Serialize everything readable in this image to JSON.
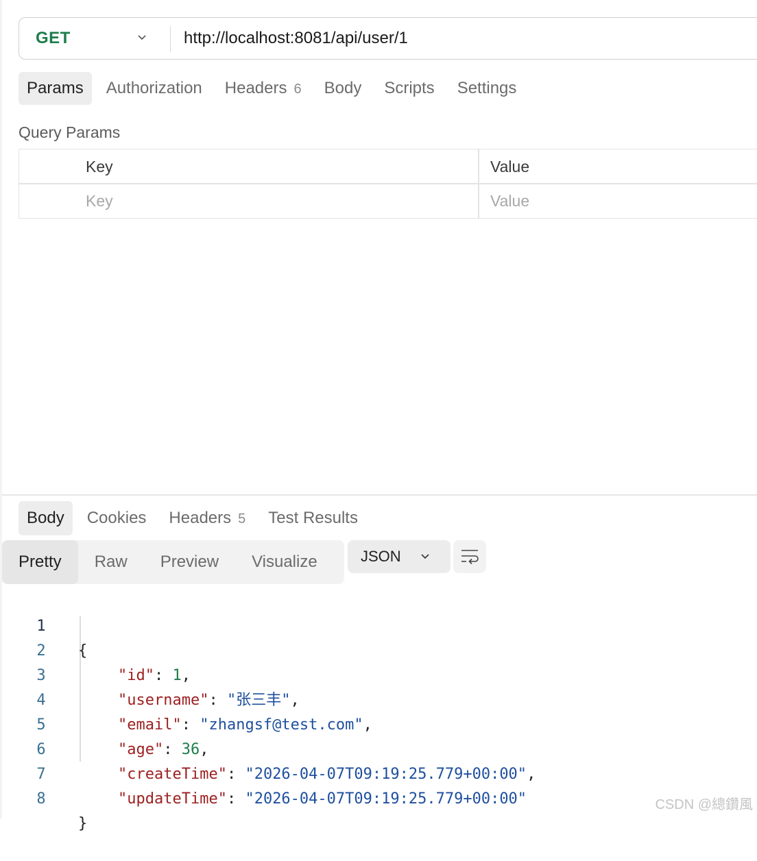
{
  "request": {
    "method": "GET",
    "url": "http://localhost:8081/api/user/1"
  },
  "request_tabs": [
    {
      "label": "Params",
      "active": true
    },
    {
      "label": "Authorization"
    },
    {
      "label": "Headers",
      "count": "6"
    },
    {
      "label": "Body"
    },
    {
      "label": "Scripts"
    },
    {
      "label": "Settings"
    }
  ],
  "query_params": {
    "title": "Query Params",
    "headers": {
      "key": "Key",
      "value": "Value"
    },
    "placeholders": {
      "key": "Key",
      "value": "Value"
    }
  },
  "response_tabs": [
    {
      "label": "Body",
      "active": true
    },
    {
      "label": "Cookies"
    },
    {
      "label": "Headers",
      "count": "5"
    },
    {
      "label": "Test Results"
    }
  ],
  "view_modes": [
    {
      "label": "Pretty",
      "active": true
    },
    {
      "label": "Raw"
    },
    {
      "label": "Preview"
    },
    {
      "label": "Visualize"
    }
  ],
  "format": "JSON",
  "code": {
    "line_numbers": [
      "1",
      "2",
      "3",
      "4",
      "5",
      "6",
      "7",
      "8"
    ],
    "open_brace": "{",
    "close_brace": "}",
    "fields": [
      {
        "key": "\"id\"",
        "value": "1",
        "type": "number",
        "comma": ","
      },
      {
        "key": "\"username\"",
        "value": "\"张三丰\"",
        "type": "string",
        "comma": ","
      },
      {
        "key": "\"email\"",
        "value": "\"zhangsf@test.com\"",
        "type": "string",
        "comma": ","
      },
      {
        "key": "\"age\"",
        "value": "36",
        "type": "number",
        "comma": ","
      },
      {
        "key": "\"createTime\"",
        "value": "\"2026-04-07T09:19:25.779+00:00\"",
        "type": "string",
        "comma": ","
      },
      {
        "key": "\"updateTime\"",
        "value": "\"2026-04-07T09:19:25.779+00:00\"",
        "type": "string",
        "comma": ""
      }
    ]
  },
  "watermark": "CSDN @總鑽風",
  "colors": {
    "method": "#1d7d4b",
    "json_key": "#9c1f1f",
    "json_string": "#1e4f9e",
    "json_number": "#1d7d4b"
  },
  "icons": {
    "method_dropdown": "chevron-down-icon",
    "format_dropdown": "chevron-down-icon",
    "wrap": "text-wrap-icon"
  }
}
